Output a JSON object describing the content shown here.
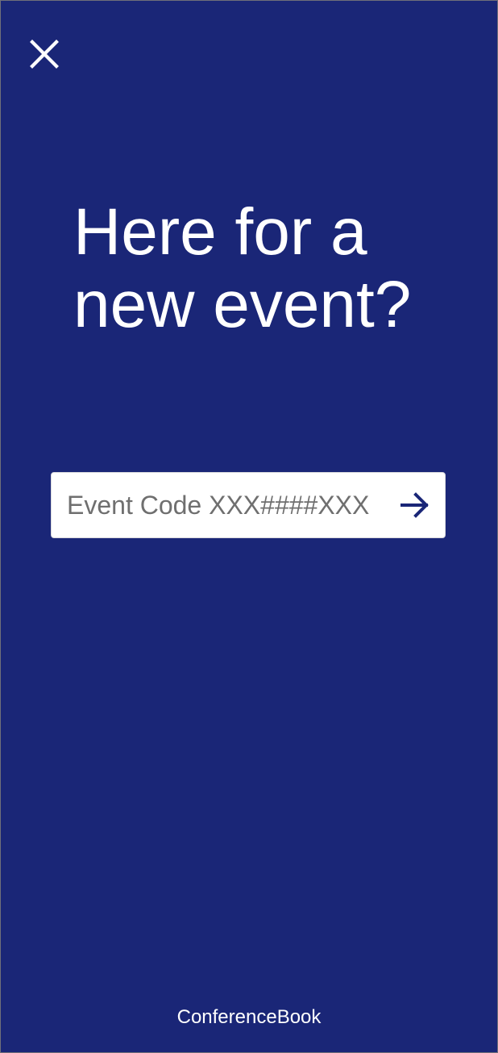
{
  "screen": {
    "background_color": "#1a2677",
    "accent_color": "#1a2677"
  },
  "header": {
    "close_icon": "close-icon"
  },
  "main": {
    "headline_line1": "Here for a",
    "headline_line2": "new event?",
    "event_code_input": {
      "value": "",
      "placeholder": "Event Code XXX####XXX"
    },
    "submit_icon": "arrow-right-icon"
  },
  "footer": {
    "brand": "ConferenceBook"
  }
}
